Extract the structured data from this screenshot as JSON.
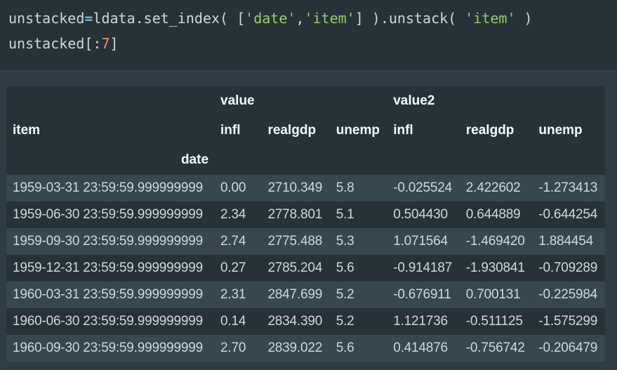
{
  "code": {
    "line1": {
      "var": "unstacked",
      "assign": "=",
      "obj": "ldata.set_index(",
      "bracket_open": " [",
      "str1": "'date'",
      "comma": ",",
      "str2": "'item'",
      "bracket_close": "] ).unstack(",
      "space": " ",
      "str3": "'item'",
      "end": " )"
    },
    "line2": {
      "var": "unstacked[:",
      "num": "7",
      "end": "]"
    }
  },
  "table": {
    "header": {
      "level0": [
        "",
        "value",
        "",
        "",
        "value2",
        "",
        ""
      ],
      "columns_name": "item",
      "level1": [
        "infl",
        "realgdp",
        "unemp",
        "infl",
        "realgdp",
        "unemp"
      ],
      "index_name": "date"
    },
    "rows": [
      {
        "index": "1959-03-31 23:59:59.999999999",
        "cells": [
          "0.00",
          "2710.349",
          "5.8",
          "-0.025524",
          "2.422602",
          "-1.273413"
        ]
      },
      {
        "index": "1959-06-30 23:59:59.999999999",
        "cells": [
          "2.34",
          "2778.801",
          "5.1",
          "0.504430",
          "0.644889",
          "-0.644254"
        ]
      },
      {
        "index": "1959-09-30 23:59:59.999999999",
        "cells": [
          "2.74",
          "2775.488",
          "5.3",
          "1.071564",
          "-1.469420",
          "1.884454"
        ]
      },
      {
        "index": "1959-12-31 23:59:59.999999999",
        "cells": [
          "0.27",
          "2785.204",
          "5.6",
          "-0.914187",
          "-1.930841",
          "-0.709289"
        ]
      },
      {
        "index": "1960-03-31 23:59:59.999999999",
        "cells": [
          "2.31",
          "2847.699",
          "5.2",
          "-0.676911",
          "0.700131",
          "-0.225984"
        ]
      },
      {
        "index": "1960-06-30 23:59:59.999999999",
        "cells": [
          "0.14",
          "2834.390",
          "5.2",
          "1.121736",
          "-0.511125",
          "-1.575299"
        ]
      },
      {
        "index": "1960-09-30 23:59:59.999999999",
        "cells": [
          "2.70",
          "2839.022",
          "5.6",
          "0.414876",
          "-0.756742",
          "-0.206479"
        ]
      }
    ]
  },
  "colors": {
    "background": "#263238",
    "output_background": "#2e3c43",
    "row_stripe": "#37474f",
    "string": "#9ccc65",
    "number": "#f78c6c",
    "operator": "#89ddff"
  }
}
